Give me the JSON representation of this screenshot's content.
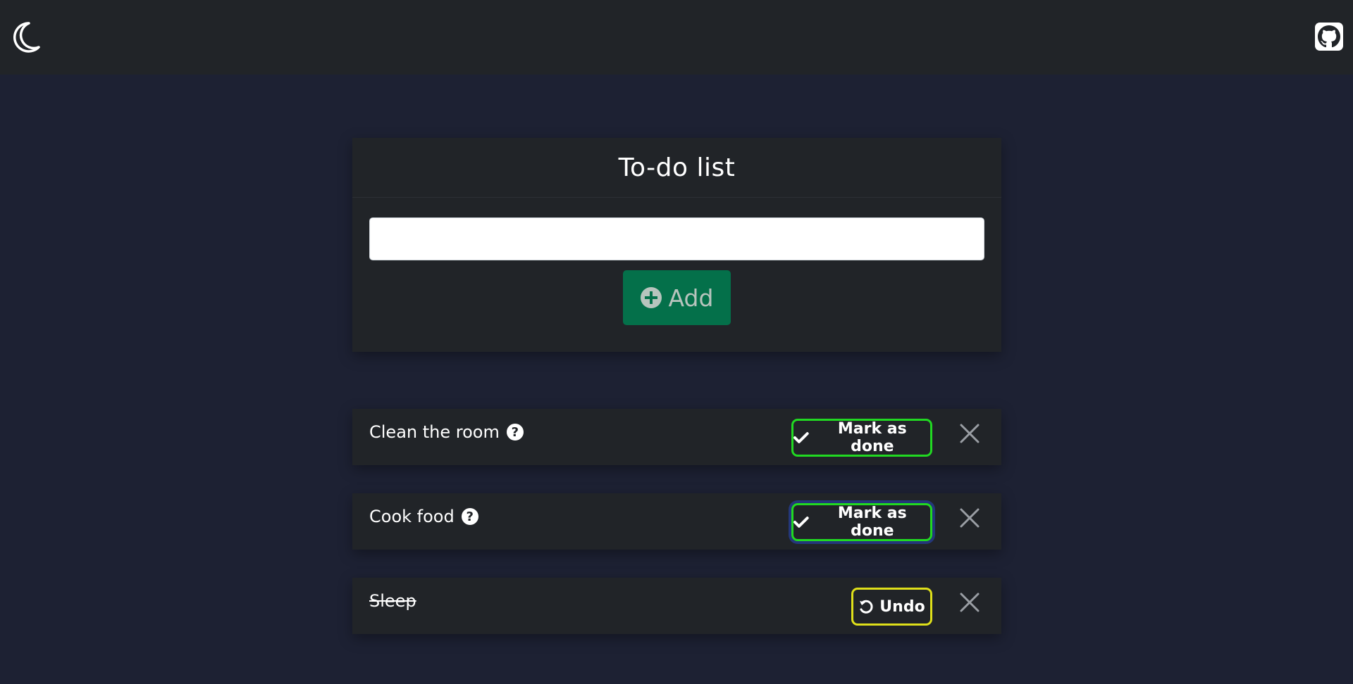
{
  "navbar": {
    "theme_icon": "moon-icon",
    "github_icon": "github-icon"
  },
  "main": {
    "title": "To-do list",
    "input_value": "",
    "add_label": "Add",
    "add_icon": "plus-circle-icon"
  },
  "tasks": [
    {
      "text": "Clean the room",
      "done": false,
      "has_help": true,
      "help_glyph": "?",
      "action_label": "Mark as done",
      "action_icon": "check-icon"
    },
    {
      "text": "Cook food",
      "done": false,
      "has_help": true,
      "help_glyph": "?",
      "action_label": "Mark as done",
      "action_icon": "check-icon"
    },
    {
      "text": "Sleep",
      "done": true,
      "has_help": false,
      "action_label": "Undo",
      "action_icon": "undo-icon"
    }
  ],
  "colors": {
    "background": "#1d2133",
    "card": "#212428",
    "add_button": "#04704a",
    "mark_done_border": "#21d922",
    "undo_border": "#dfe01a"
  }
}
